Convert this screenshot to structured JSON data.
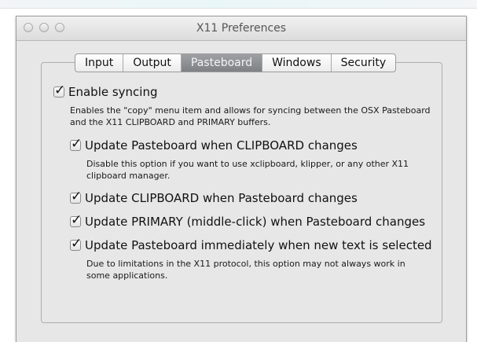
{
  "window": {
    "title": "X11 Preferences"
  },
  "tabs": [
    {
      "label": "Input",
      "active": false
    },
    {
      "label": "Output",
      "active": false
    },
    {
      "label": "Pasteboard",
      "active": true
    },
    {
      "label": "Windows",
      "active": false
    },
    {
      "label": "Security",
      "active": false
    }
  ],
  "pasteboard": {
    "enable_syncing": {
      "label": "Enable syncing",
      "checked": true,
      "description": "Enables the \"copy\" menu item and allows for syncing between the OSX Pasteboard and the X11 CLIPBOARD and PRIMARY buffers."
    },
    "options": [
      {
        "label": "Update Pasteboard when CLIPBOARD changes",
        "checked": true,
        "description": "Disable this option if you want to use xclipboard, klipper, or any other X11 clipboard manager."
      },
      {
        "label": "Update CLIPBOARD when Pasteboard changes",
        "checked": true
      },
      {
        "label": "Update PRIMARY (middle-click) when Pasteboard changes",
        "checked": true
      },
      {
        "label": "Update Pasteboard immediately when new text is selected",
        "checked": true,
        "description": "Due to limitations in the X11 protocol, this option may not always work in some applications."
      }
    ]
  },
  "colors": {
    "window_bg": "#e7e7e7",
    "active_tab_bg": "#8f9094",
    "active_tab_text": "#f4f4f4"
  }
}
